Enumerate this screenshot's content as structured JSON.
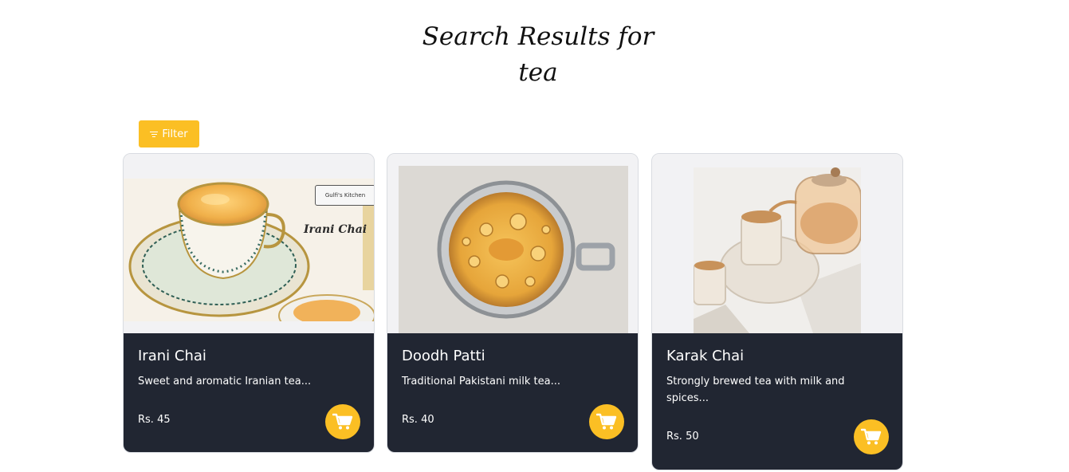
{
  "header": {
    "title_line1": "Search Results for",
    "title_line2": "tea"
  },
  "filter": {
    "label": "Filter",
    "color": "#fbbf24"
  },
  "products": [
    {
      "name": "Irani Chai",
      "description": "Sweet and aromatic Iranian tea...",
      "price": "Rs. 45",
      "image_logo_text": "Gulfi's Kitchen",
      "image_caption": "Irani Chai"
    },
    {
      "name": "Doodh Patti",
      "description": "Traditional Pakistani milk tea...",
      "price": "Rs. 40"
    },
    {
      "name": "Karak Chai",
      "description": "Strongly brewed tea with milk and spices...",
      "price": "Rs. 50"
    }
  ],
  "icons": {
    "filter": "filter-icon",
    "cart": "shopping-cart-icon"
  },
  "colors": {
    "accent": "#fbbf24",
    "card_body": "#212632"
  }
}
